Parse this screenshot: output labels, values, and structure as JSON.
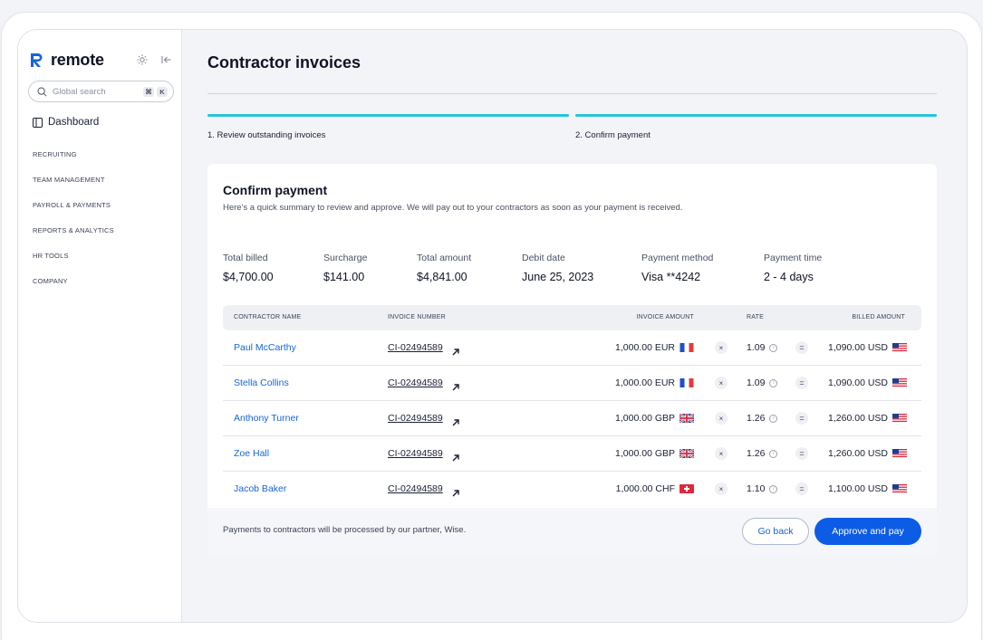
{
  "sidebar": {
    "brand": "remote",
    "search_placeholder": "Global search",
    "kbd_cmd": "⌘",
    "kbd_k": "K",
    "dashboard": "Dashboard",
    "sections": [
      "RECRUITING",
      "TEAM MANAGEMENT",
      "PAYROLL & PAYMENTS",
      "REPORTS & ANALYTICS",
      "HR TOOLS",
      "COMPANY"
    ]
  },
  "page": {
    "title": "Contractor invoices",
    "steps": [
      "1. Review outstanding invoices",
      "2. Confirm payment"
    ]
  },
  "card": {
    "title": "Confirm payment",
    "subtitle": "Here's a quick summary to review and approve. We will pay out to your contractors as soon as your payment is received.",
    "stats": [
      {
        "label": "Total billed",
        "value": "$4,700.00"
      },
      {
        "label": "Surcharge",
        "value": "$141.00"
      },
      {
        "label": "Total amount",
        "value": "$4,841.00"
      },
      {
        "label": "Debit date",
        "value": "June 25, 2023"
      },
      {
        "label": "Payment method",
        "value": "Visa **4242"
      },
      {
        "label": "Payment time",
        "value": "2 - 4 days"
      }
    ],
    "columns": [
      "CONTRACTOR NAME",
      "INVOICE NUMBER",
      "INVOICE AMOUNT",
      "RATE",
      "BILLED AMOUNT"
    ],
    "rows": [
      {
        "name": "Paul McCarthy",
        "invoice": "CI-02494589",
        "amount": "1,000.00 EUR",
        "flag": "fr",
        "rate": "1.09",
        "billed": "1,090.00 USD"
      },
      {
        "name": "Stella Collins",
        "invoice": "CI-02494589",
        "amount": "1,000.00 EUR",
        "flag": "fr",
        "rate": "1.09",
        "billed": "1,090.00 USD"
      },
      {
        "name": "Anthony Turner",
        "invoice": "CI-02494589",
        "amount": "1,000.00 GBP",
        "flag": "gb",
        "rate": "1.26",
        "billed": "1,260.00 USD"
      },
      {
        "name": "Zoe Hall",
        "invoice": "CI-02494589",
        "amount": "1,000.00 GBP",
        "flag": "gb",
        "rate": "1.26",
        "billed": "1,260.00 USD"
      },
      {
        "name": "Jacob Baker",
        "invoice": "CI-02494589",
        "amount": "1,000.00 CHF",
        "flag": "ch",
        "rate": "1.10",
        "billed": "1,100.00 USD"
      }
    ],
    "footer_text": "Payments to contractors will be processed by our partner, Wise.",
    "back_label": "Go back",
    "pay_label": "Approve and pay"
  },
  "colors": {
    "accent": "#0d5ce6",
    "link": "#1565d8",
    "step": "#27c2e0"
  }
}
